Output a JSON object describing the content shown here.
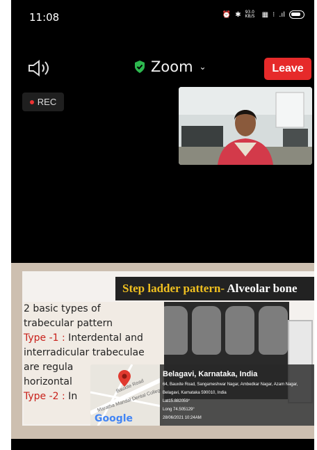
{
  "status_bar": {
    "time": "11:08",
    "icons": [
      "alarm-icon",
      "bluetooth-icon",
      "data-speed-icon",
      "volte-icon",
      "wifi-icon",
      "signal-icon",
      "battery-icon"
    ],
    "data_speed": "93.0 KB/S"
  },
  "meeting": {
    "title": "Zoom",
    "leave_label": "Leave",
    "rec_label": "REC",
    "colors": {
      "leave": "#e62a2a",
      "shield": "#2db84f"
    }
  },
  "slide": {
    "title_highlight": "Step ladder pattern-",
    "title_rest": " Alveolar bone",
    "line1": "2 basic types of",
    "line2": "trabecular pattern",
    "type1_label": "Type -1 :",
    "type1_text": " Interdental and",
    "line4": "interradicular trabeculae",
    "line5": "are regula",
    "line6": "horizontal",
    "type2_label": "Type -2 :",
    "type2_text": " In"
  },
  "geotag": {
    "title": "Belagavi, Karnataka, India",
    "address1": "64, Bauxite Road, Sangameshwar Nagar, Ambedkar Nagar, Azam Nagar,",
    "address2": "Belagavi, Karnataka 590010, India",
    "lat": "Lat15.882059°",
    "long": "Long 74.505129°",
    "datetime": "28/06/2021 10:24AM",
    "map_labels": {
      "road": "Bauxite Road",
      "area": "Maratha Mandal Dental College"
    },
    "google": "Google"
  }
}
